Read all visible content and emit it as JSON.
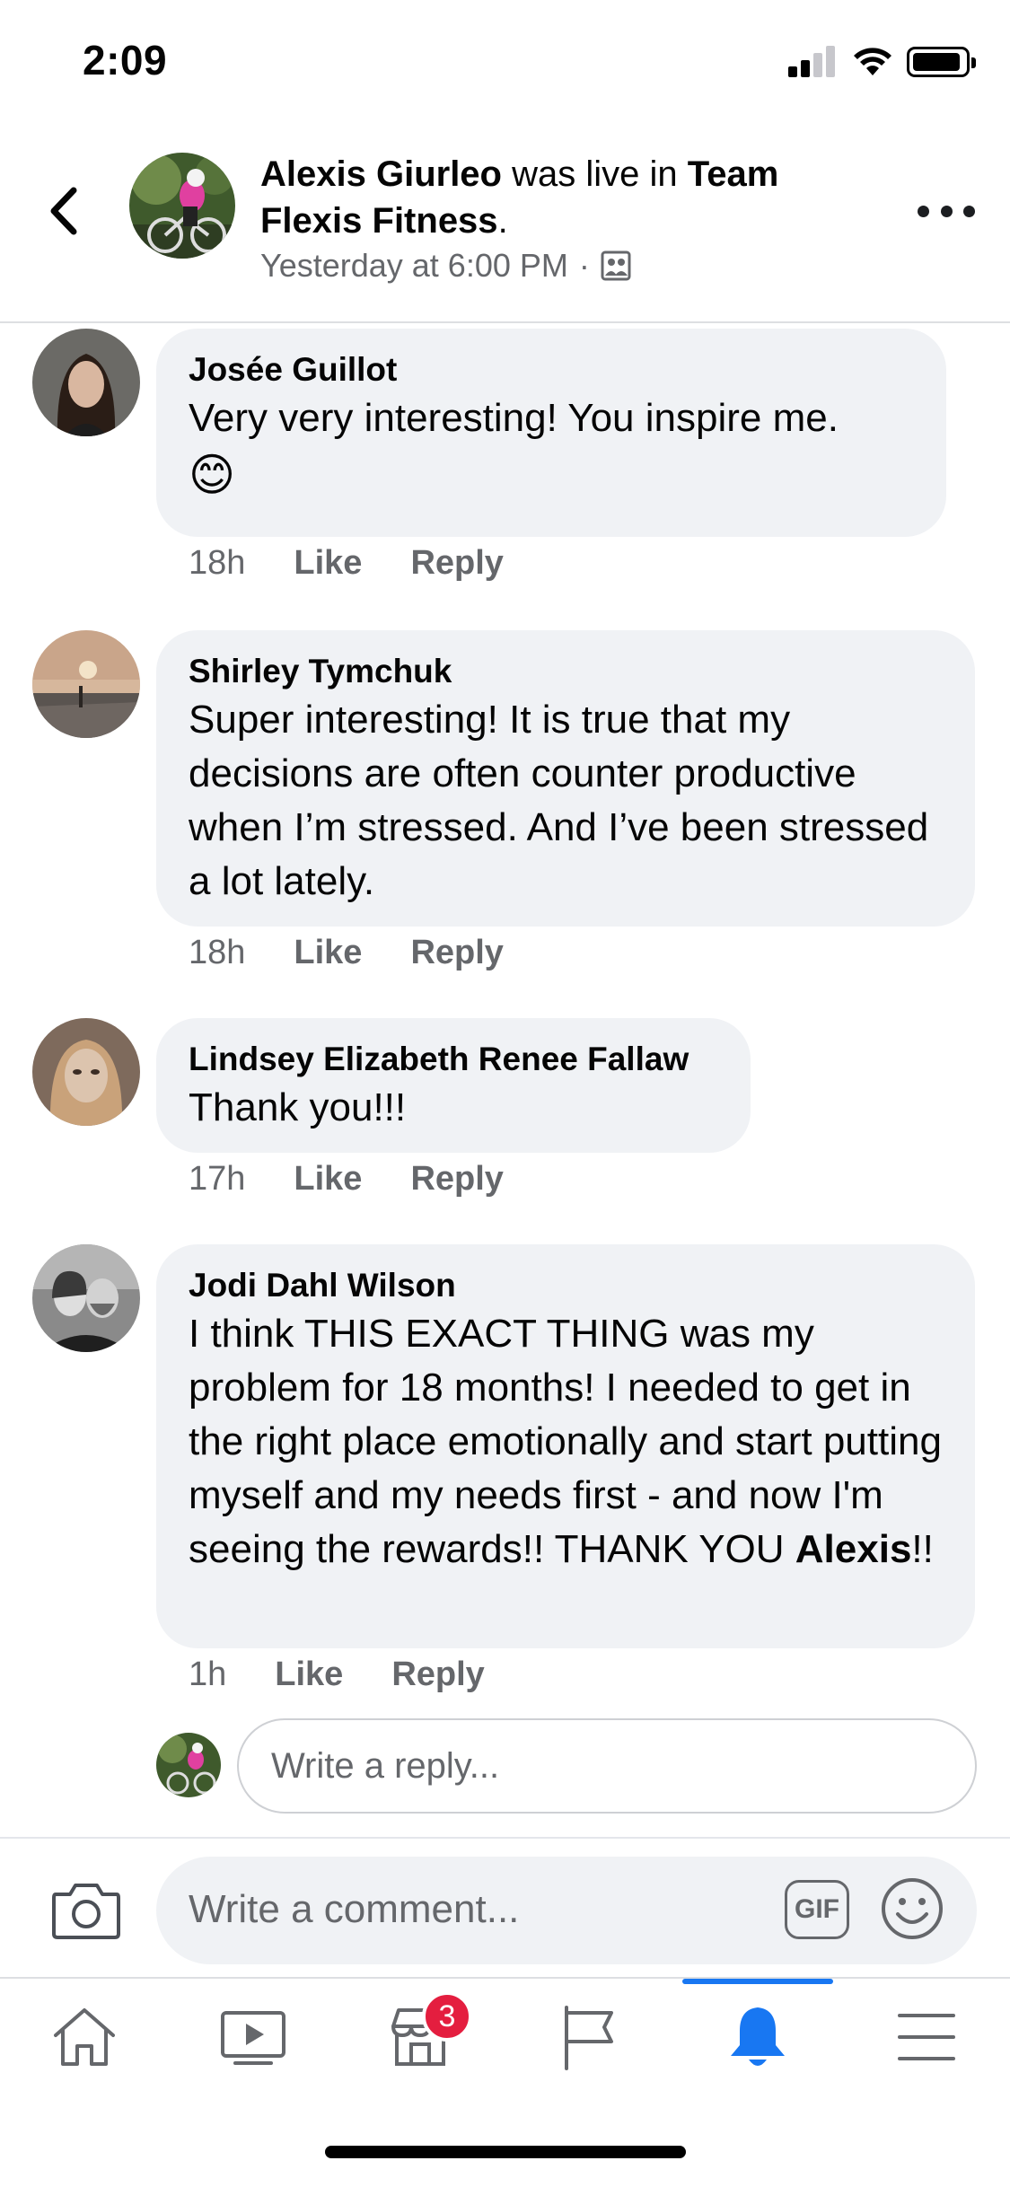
{
  "status_bar": {
    "time": "2:09"
  },
  "header": {
    "author": "Alexis Giurleo",
    "action": " was live in ",
    "group": "Team Flexis Fitness",
    "period": ".",
    "meta": "Yesterday at 6:00 PM",
    "separator": "·"
  },
  "comments": [
    {
      "name": "Josée Guillot",
      "text": "Very very interesting! You inspire me.",
      "emoji": "😊",
      "time": "18h",
      "like": "Like",
      "reply": "Reply"
    },
    {
      "name": "Shirley Tymchuk",
      "text": "Super interesting! It is true that my decisions are often counter productive when I’m stressed. And I’ve been stressed a lot lately.",
      "time": "18h",
      "like": "Like",
      "reply": "Reply"
    },
    {
      "name": "Lindsey Elizabeth Renee Fallaw",
      "text": "Thank you!!!",
      "time": "17h",
      "like": "Like",
      "reply": "Reply"
    },
    {
      "name": "Jodi Dahl Wilson",
      "text": "I think THIS EXACT THING was my problem for 18 months! I needed to get in the right place emotionally and start putting myself and my needs first - and now I'm seeing the rewards!! THANK YOU ",
      "mention": "Alexis",
      "text_end": "!!",
      "time": "1h",
      "like": "Like",
      "reply": "Reply"
    }
  ],
  "reply_box": {
    "placeholder": "Write a reply..."
  },
  "composer": {
    "placeholder": "Write a comment...",
    "gif_label": "GIF"
  },
  "tabbar": {
    "tabs": [
      "home",
      "watch",
      "marketplace",
      "pages",
      "notifications",
      "menu"
    ],
    "marketplace_badge": "3",
    "active_tab": "notifications"
  },
  "colors": {
    "accent": "#1877f2",
    "badge": "#e41e3f",
    "bubble": "#f0f2f5",
    "secondary_text": "#65676b"
  }
}
